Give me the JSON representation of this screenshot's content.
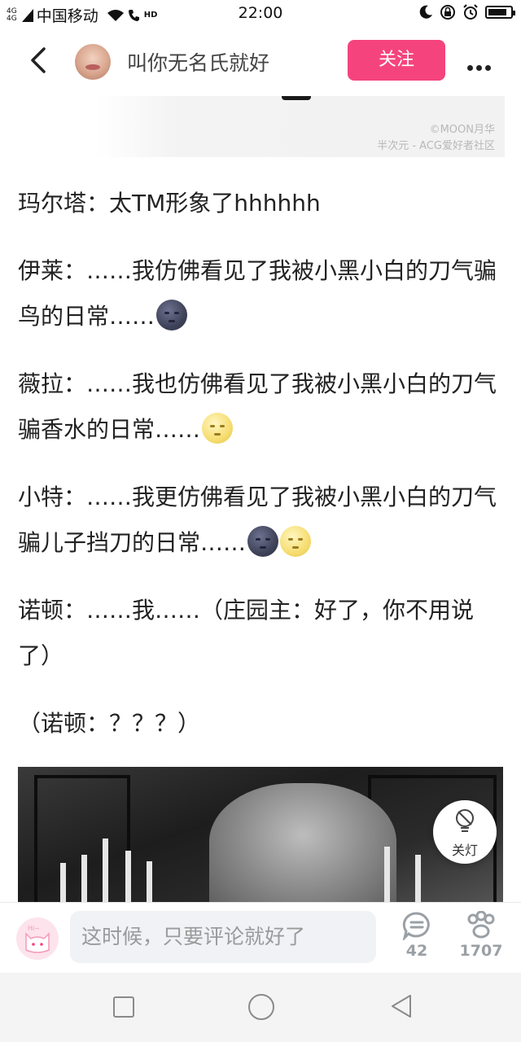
{
  "status_bar": {
    "network_type_top": "4G",
    "network_type_bottom": "4G",
    "carrier": "中国移动",
    "hd_label": "HD",
    "time": "22:00",
    "battery_level": 0.85
  },
  "header": {
    "author_name": "叫你无名氏就好",
    "follow_label": "关注"
  },
  "watermark": {
    "line1": "©MOON月华",
    "line2": "半次元 - ACG爱好者社区"
  },
  "article": {
    "paragraphs": [
      {
        "text": "玛尔塔：太TM形象了hhhhhh"
      },
      {
        "text": "伊莱：……我仿佛看见了我被小黑小白的刀气骗鸟的日常……",
        "emoji": [
          "new-moon-face"
        ]
      },
      {
        "text": "薇拉：……我也仿佛看见了我被小黑小白的刀气骗香水的日常……",
        "emoji": [
          "full-moon-face"
        ]
      },
      {
        "text": "小特：……我更仿佛看见了我被小黑小白的刀气骗儿子挡刀的日常……",
        "emoji": [
          "new-moon-face",
          "full-moon-face"
        ]
      },
      {
        "text": "诺顿：……我……（庄园主：好了，你不用说了）"
      },
      {
        "text": "（诺顿：？？？）"
      }
    ]
  },
  "lamp_toggle": {
    "label": "关灯"
  },
  "comment_bar": {
    "placeholder": "这时候，只要评论就好了",
    "comment_count": "42",
    "like_count": "1707"
  },
  "colors": {
    "accent_pink": "#f5447d",
    "stat_gray": "#9aa0a6"
  }
}
